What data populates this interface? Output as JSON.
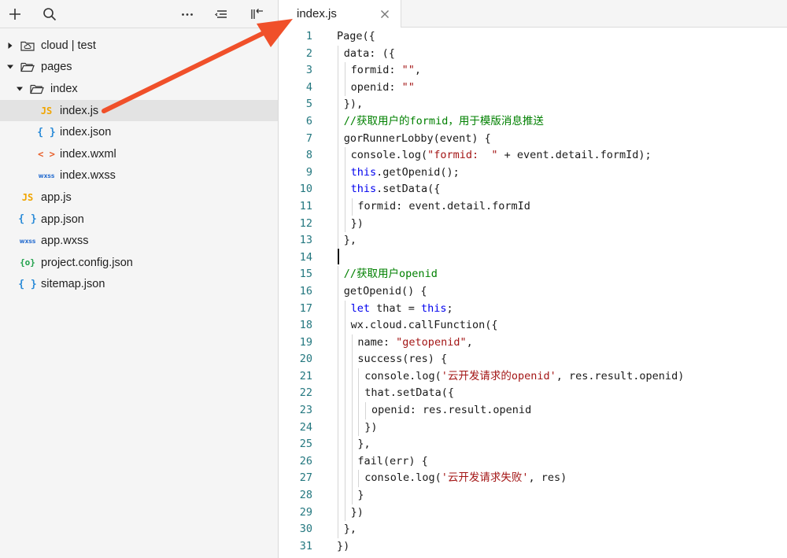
{
  "toolbar": {
    "buttons": [
      {
        "name": "add-icon"
      },
      {
        "name": "search-icon"
      },
      {
        "name": "more-icon"
      },
      {
        "name": "sort-icon"
      },
      {
        "name": "collapse-panel-icon"
      }
    ]
  },
  "tree": [
    {
      "label": "cloud | test",
      "type": "cloud-folder",
      "caret": "right",
      "depth": 0
    },
    {
      "label": "pages",
      "type": "folder",
      "caret": "down",
      "depth": 0
    },
    {
      "label": "index",
      "type": "folder",
      "caret": "down",
      "depth": 1
    },
    {
      "label": "index.js",
      "type": "js",
      "icon": "JS",
      "depth": 2,
      "selected": true
    },
    {
      "label": "index.json",
      "type": "json",
      "icon": "{ }",
      "depth": 2
    },
    {
      "label": "index.wxml",
      "type": "wxml",
      "icon": "< >",
      "depth": 2
    },
    {
      "label": "index.wxss",
      "type": "wxss",
      "icon": "wxss",
      "depth": 2
    },
    {
      "label": "app.js",
      "type": "js",
      "icon": "JS",
      "depth": 0
    },
    {
      "label": "app.json",
      "type": "json",
      "icon": "{ }",
      "depth": 0
    },
    {
      "label": "app.wxss",
      "type": "wxss",
      "icon": "wxss",
      "depth": 0
    },
    {
      "label": "project.config.json",
      "type": "config",
      "icon": "{o}",
      "depth": 0
    },
    {
      "label": "sitemap.json",
      "type": "json",
      "icon": "{ }",
      "depth": 0
    }
  ],
  "editor": {
    "tab": {
      "label": "index.js",
      "close_icon": "close-icon"
    },
    "lines": [
      {
        "n": "1",
        "indent": 0,
        "tokens": [
          [
            "Page({",
            ""
          ]
        ]
      },
      {
        "n": "2",
        "indent": 1,
        "tokens": [
          [
            "data: ({",
            ""
          ]
        ]
      },
      {
        "n": "3",
        "indent": 2,
        "tokens": [
          [
            "formid: ",
            ""
          ],
          [
            "\"\"",
            "str"
          ],
          [
            ",",
            ""
          ]
        ]
      },
      {
        "n": "4",
        "indent": 2,
        "tokens": [
          [
            "openid: ",
            ""
          ],
          [
            "\"\"",
            "str"
          ]
        ]
      },
      {
        "n": "5",
        "indent": 1,
        "tokens": [
          [
            "}),",
            ""
          ]
        ]
      },
      {
        "n": "6",
        "indent": 1,
        "tokens": [
          [
            "//获取用户的formid，用于模版消息推送",
            "cm"
          ]
        ]
      },
      {
        "n": "7",
        "indent": 1,
        "tokens": [
          [
            "gorRunnerLobby(event) {",
            ""
          ]
        ]
      },
      {
        "n": "8",
        "indent": 2,
        "tokens": [
          [
            "console.log(",
            ""
          ],
          [
            "\"formid:  \"",
            "str"
          ],
          [
            " + event.detail.formId);",
            ""
          ]
        ]
      },
      {
        "n": "9",
        "indent": 2,
        "tokens": [
          [
            "this",
            "kw"
          ],
          [
            ".getOpenid();",
            ""
          ]
        ]
      },
      {
        "n": "10",
        "indent": 2,
        "tokens": [
          [
            "this",
            "kw"
          ],
          [
            ".setData({",
            ""
          ]
        ]
      },
      {
        "n": "11",
        "indent": 3,
        "tokens": [
          [
            "formid: event.detail.formId",
            ""
          ]
        ]
      },
      {
        "n": "12",
        "indent": 2,
        "tokens": [
          [
            "})",
            ""
          ]
        ]
      },
      {
        "n": "13",
        "indent": 1,
        "tokens": [
          [
            "},",
            ""
          ]
        ]
      },
      {
        "n": "14",
        "indent": 0,
        "tokens": []
      },
      {
        "n": "15",
        "indent": 1,
        "tokens": [
          [
            "//获取用户openid",
            "cm"
          ]
        ]
      },
      {
        "n": "16",
        "indent": 1,
        "tokens": [
          [
            "getOpenid() {",
            ""
          ]
        ]
      },
      {
        "n": "17",
        "indent": 2,
        "tokens": [
          [
            "let",
            "kw"
          ],
          [
            " that = ",
            ""
          ],
          [
            "this",
            "kw"
          ],
          [
            ";",
            ""
          ]
        ]
      },
      {
        "n": "18",
        "indent": 2,
        "tokens": [
          [
            "wx.cloud.callFunction({",
            ""
          ]
        ]
      },
      {
        "n": "19",
        "indent": 3,
        "tokens": [
          [
            "name: ",
            ""
          ],
          [
            "\"getopenid\"",
            "str"
          ],
          [
            ",",
            ""
          ]
        ]
      },
      {
        "n": "20",
        "indent": 3,
        "tokens": [
          [
            "success(res) {",
            ""
          ]
        ]
      },
      {
        "n": "21",
        "indent": 4,
        "tokens": [
          [
            "console.log(",
            ""
          ],
          [
            "'云开发请求的openid'",
            "str"
          ],
          [
            ", res.result.openid)",
            ""
          ]
        ]
      },
      {
        "n": "22",
        "indent": 4,
        "tokens": [
          [
            "that.setData({",
            ""
          ]
        ]
      },
      {
        "n": "23",
        "indent": 5,
        "tokens": [
          [
            "openid: res.result.openid",
            ""
          ]
        ]
      },
      {
        "n": "24",
        "indent": 4,
        "tokens": [
          [
            "})",
            ""
          ]
        ]
      },
      {
        "n": "25",
        "indent": 3,
        "tokens": [
          [
            "},",
            ""
          ]
        ]
      },
      {
        "n": "26",
        "indent": 3,
        "tokens": [
          [
            "fail(err) {",
            ""
          ]
        ]
      },
      {
        "n": "27",
        "indent": 4,
        "tokens": [
          [
            "console.log(",
            ""
          ],
          [
            "'云开发请求失败'",
            "str"
          ],
          [
            ", res)",
            ""
          ]
        ]
      },
      {
        "n": "28",
        "indent": 3,
        "tokens": [
          [
            "}",
            ""
          ]
        ]
      },
      {
        "n": "29",
        "indent": 2,
        "tokens": [
          [
            "})",
            ""
          ]
        ]
      },
      {
        "n": "30",
        "indent": 1,
        "tokens": [
          [
            "},",
            ""
          ]
        ]
      },
      {
        "n": "31",
        "indent": 0,
        "tokens": [
          [
            "})",
            ""
          ]
        ]
      }
    ]
  },
  "colors": {
    "annotation_arrow": "#f0502a",
    "line_number": "#23777f",
    "keyword": "#0000ee",
    "string": "#a31515",
    "comment": "#008000"
  }
}
